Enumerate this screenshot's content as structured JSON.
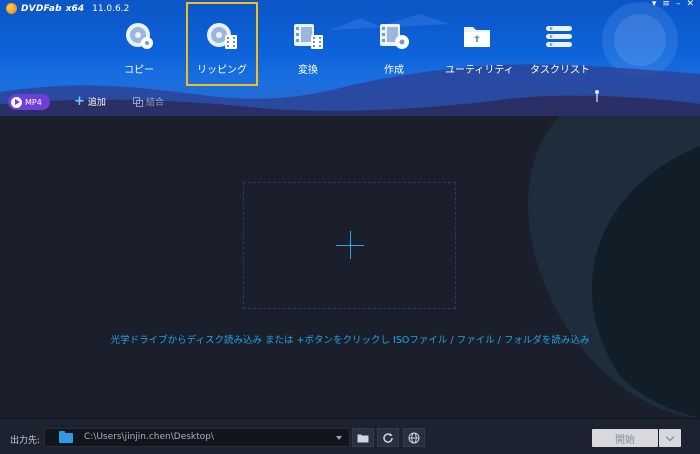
{
  "app": {
    "brand": "DVDFab",
    "arch": "x64",
    "version": "11.0.6.2"
  },
  "window_controls": [
    "pin-icon",
    "menu-icon",
    "minimize-icon",
    "close-icon"
  ],
  "toolbar": {
    "items": [
      {
        "label": "コピー",
        "icon": "copy-disc-icon",
        "active": false
      },
      {
        "label": "リッピング",
        "icon": "ripper-disc-icon",
        "active": true
      },
      {
        "label": "変換",
        "icon": "converter-film-icon",
        "active": false
      },
      {
        "label": "作成",
        "icon": "creator-film-disc-icon",
        "active": false
      },
      {
        "label": "ユーティリティ",
        "icon": "utility-folder-icon",
        "active": false
      },
      {
        "label": "タスクリスト",
        "icon": "task-list-icon",
        "active": false
      }
    ],
    "active_border_color": "#f2c018"
  },
  "subbar": {
    "format_label": "MP4",
    "add_label": "追加",
    "merge_label": "結合"
  },
  "main": {
    "hint": "光学ドライブからディスク読み込み または +ボタンをクリックし ISOファイル / ファイル / フォルダを読み込み"
  },
  "footer": {
    "output_label": "出力先:",
    "output_path": "C:\\Users\\jinjin.chen\\Desktop\\",
    "start_label": "開始"
  },
  "colors": {
    "header_blue": "#0d63d9",
    "accent_purple": "#6d3fd8",
    "hint_blue": "#1fa6e8"
  }
}
